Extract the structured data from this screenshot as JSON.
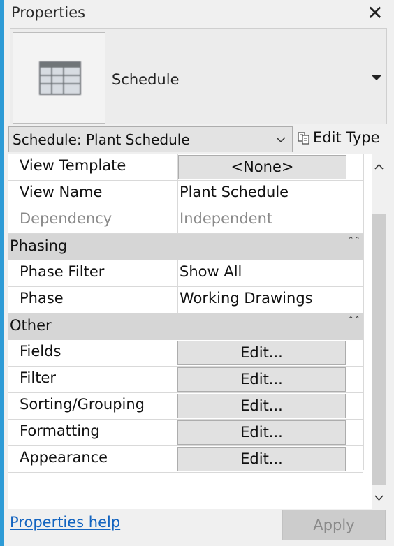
{
  "palette": {
    "accent_bar": "#2e9bd6",
    "link": "#1464c0",
    "group_header_bg": "#d6d6d6",
    "disabled_text": "#8a8a8a"
  },
  "panel": {
    "title": "Properties",
    "close_icon": "close-x-icon"
  },
  "type_selector": {
    "thumbnail_icon": "schedule-table-icon",
    "type_name": "Schedule",
    "dropdown_icon": "triangle-down-icon"
  },
  "instance_filter": {
    "selected": "Schedule: Plant Schedule",
    "chevron_icon": "chevron-down-icon"
  },
  "edit_type": {
    "label": "Edit Type",
    "icon": "edit-type-icon"
  },
  "properties": {
    "top_rows": [
      {
        "label": "View Template",
        "value": "<None>",
        "kind": "button"
      },
      {
        "label": "View Name",
        "value": "Plant Schedule",
        "kind": "text"
      },
      {
        "label": "Dependency",
        "value": "Independent",
        "kind": "disabled"
      }
    ],
    "phasing": {
      "header": "Phasing",
      "rows": [
        {
          "label": "Phase Filter",
          "value": "Show All"
        },
        {
          "label": "Phase",
          "value": "Working Drawings"
        }
      ]
    },
    "other": {
      "header": "Other",
      "rows": [
        {
          "label": "Fields",
          "value": "Edit..."
        },
        {
          "label": "Filter",
          "value": "Edit..."
        },
        {
          "label": "Sorting/Grouping",
          "value": "Edit..."
        },
        {
          "label": "Formatting",
          "value": "Edit..."
        },
        {
          "label": "Appearance",
          "value": "Edit..."
        }
      ]
    },
    "collapse_glyph": "⌃⌃"
  },
  "footer": {
    "help_link": "Properties help",
    "apply_label": "Apply"
  }
}
